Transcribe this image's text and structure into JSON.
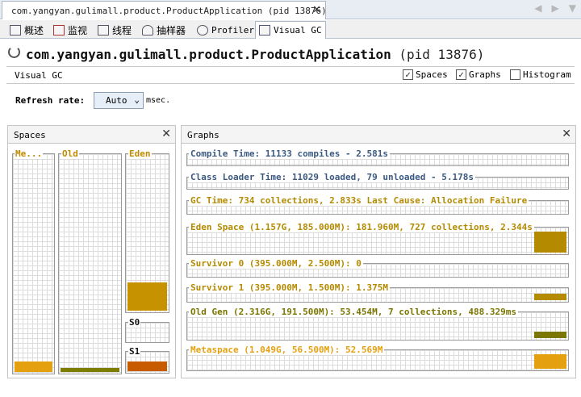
{
  "doc_tab": {
    "title": "com.yangyan.gulimall.product.ProductApplication (pid 13876)",
    "close": "✕"
  },
  "nav": {
    "left": "◀",
    "right": "▶",
    "down": "▼"
  },
  "tool_tabs": [
    {
      "label": "概述",
      "icon": "overview-icon"
    },
    {
      "label": "监视",
      "icon": "monitor-icon"
    },
    {
      "label": "线程",
      "icon": "threads-icon"
    },
    {
      "label": "抽样器",
      "icon": "sampler-icon"
    },
    {
      "label": "Profiler",
      "icon": "profiler-icon"
    },
    {
      "label": "Visual GC",
      "icon": "visual-gc-icon",
      "active": true
    }
  ],
  "header": {
    "name": "com.yangyan.gulimall.product.ProductApplication",
    "pid": "(pid 13876)"
  },
  "vgc": {
    "title": "Visual GC",
    "options": [
      {
        "label": "Spaces",
        "checked": true,
        "mark": "✓"
      },
      {
        "label": "Graphs",
        "checked": true,
        "mark": "✓"
      },
      {
        "label": "Histogram",
        "checked": false,
        "mark": ""
      }
    ]
  },
  "refresh": {
    "label": "Refresh rate:",
    "value": "Auto",
    "chevron": "⌄",
    "unit": "msec."
  },
  "spaces_panel": {
    "title": "Spaces",
    "close": "✕",
    "columns": [
      {
        "label": "Me...",
        "fill": 0.05,
        "color": "#e5a010"
      },
      {
        "label": "Old",
        "fill": 0.02,
        "color": "#7d7d00"
      },
      {
        "label": "Eden",
        "fill": 0.18,
        "color": "#c79200"
      },
      {
        "label": "S0",
        "fill": 0.0,
        "color": "#c85a00"
      },
      {
        "label": "S1",
        "fill": 0.55,
        "color": "#c85a00"
      }
    ]
  },
  "graphs_panel": {
    "title": "Graphs",
    "close": "✕",
    "items": [
      {
        "text": "Compile Time: 11133 compiles - 2.581s",
        "color": "#3a5a80",
        "level": 0.0
      },
      {
        "text": "Class Loader Time: 11029 loaded, 79 unloaded - 5.178s",
        "color": "#3a5a80",
        "level": 0.0
      },
      {
        "text": "GC Time: 734 collections, 2.833s  Last Cause: Allocation Failure",
        "color": "#b38a00",
        "level": 0.0
      },
      {
        "text": "Eden Space (1.157G, 185.000M): 181.960M, 727 collections, 2.344s",
        "color": "#b38a00",
        "level": 0.9
      },
      {
        "text": "Survivor 0 (395.000M, 2.500M): 0",
        "color": "#b38a00",
        "level": 0.0
      },
      {
        "text": "Survivor 1 (395.000M, 1.500M): 1.375M",
        "color": "#b38a00",
        "level": 0.6
      },
      {
        "text": "Old Gen (2.316G, 191.500M): 53.454M, 7 collections, 488.329ms",
        "color": "#7a7600",
        "level": 0.28
      },
      {
        "text": "Metaspace (1.049G, 56.500M): 52.569M",
        "color": "#e5a010",
        "level": 0.85
      }
    ]
  }
}
